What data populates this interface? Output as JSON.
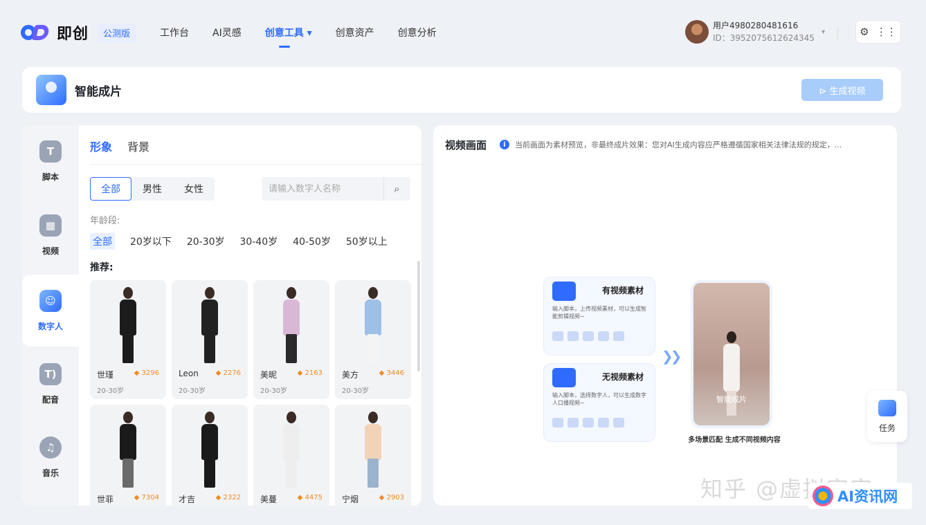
{
  "header": {
    "logo_text": "即创",
    "beta_label": "公测版",
    "nav": [
      {
        "label": "工作台"
      },
      {
        "label": "AI灵感"
      },
      {
        "label": "创意工具 ▾"
      },
      {
        "label": "创意资产"
      },
      {
        "label": "创意分析"
      }
    ],
    "user": {
      "name": "用户4980280481616",
      "id": "ID：3952075612624345"
    },
    "settings_icon": "⚙",
    "apps_icon": "⋮⋮"
  },
  "titlebar": {
    "title": "智能成片",
    "generate_label": "⊳ 生成视频"
  },
  "leftnav": {
    "items": [
      {
        "label": "脚本",
        "icon": "T"
      },
      {
        "label": "视频",
        "icon": "▦"
      },
      {
        "label": "数字人",
        "icon": "☺"
      },
      {
        "label": "配音",
        "icon": "T)"
      },
      {
        "label": "音乐",
        "icon": "♫"
      }
    ]
  },
  "panel": {
    "tabs": [
      "形象",
      "背景"
    ],
    "genders": [
      "全部",
      "男性",
      "女性"
    ],
    "search_placeholder": "请输入数字人名称",
    "age_label": "年龄段:",
    "ages": [
      "全部",
      "20岁以下",
      "20-30岁",
      "30-40岁",
      "40-50岁",
      "50岁以上"
    ],
    "recommend_label": "推荐:",
    "cards": [
      {
        "name": "世瑾",
        "hot": "◆ 3296",
        "age": "20-30岁",
        "top": "#1c1c1c",
        "bottom": "#1c1c1c"
      },
      {
        "name": "Leon",
        "hot": "◆ 2276",
        "age": "20-30岁",
        "top": "#222222",
        "bottom": "#222222"
      },
      {
        "name": "美昵",
        "hot": "◆ 2163",
        "age": "20-30岁",
        "top": "#d9b8d6",
        "bottom": "#2a2a2a"
      },
      {
        "name": "美方",
        "hot": "◆ 3446",
        "age": "20-30岁",
        "top": "#9fc0e6",
        "bottom": "#f4f4f4"
      },
      {
        "name": "世菲",
        "hot": "◆ 7304",
        "age": "",
        "top": "#1a1a1a",
        "bottom": "#6a6a6a"
      },
      {
        "name": "才吉",
        "hot": "◆ 2322",
        "age": "",
        "top": "#1a1a1a",
        "bottom": "#1a1a1a"
      },
      {
        "name": "美蔓",
        "hot": "◆ 4475",
        "age": "",
        "top": "#eeeeee",
        "bottom": "#eeeeee"
      },
      {
        "name": "宁烟",
        "hot": "◆ 2903",
        "age": "",
        "top": "#f3d3b8",
        "bottom": "#9bb3cc"
      }
    ]
  },
  "preview": {
    "title": "视频画面",
    "note": "当前画面为素材预览，非最终成片效果：您对AI生成内容应严格遵循国家相关法律法规的规定，...",
    "with_material_title": "有视频素材",
    "with_material_desc": "输入脚本，上传视频素材，可以生成智能剪辑视频~",
    "without_material_title": "无视频素材",
    "without_material_desc": "输入脚本，选择数字人，可以生成数字人口播视频~",
    "phone_label": "智能成片",
    "caption": "多场景匹配 生成不同视频内容"
  },
  "task": {
    "label": "任务"
  },
  "watermark": {
    "text": "知乎 @虚拟宇宙",
    "badge": "AI资讯网"
  },
  "colors": {
    "accent": "#2f6bff",
    "hot": "#f08a24",
    "disabled_button": "#a9cdfb"
  }
}
